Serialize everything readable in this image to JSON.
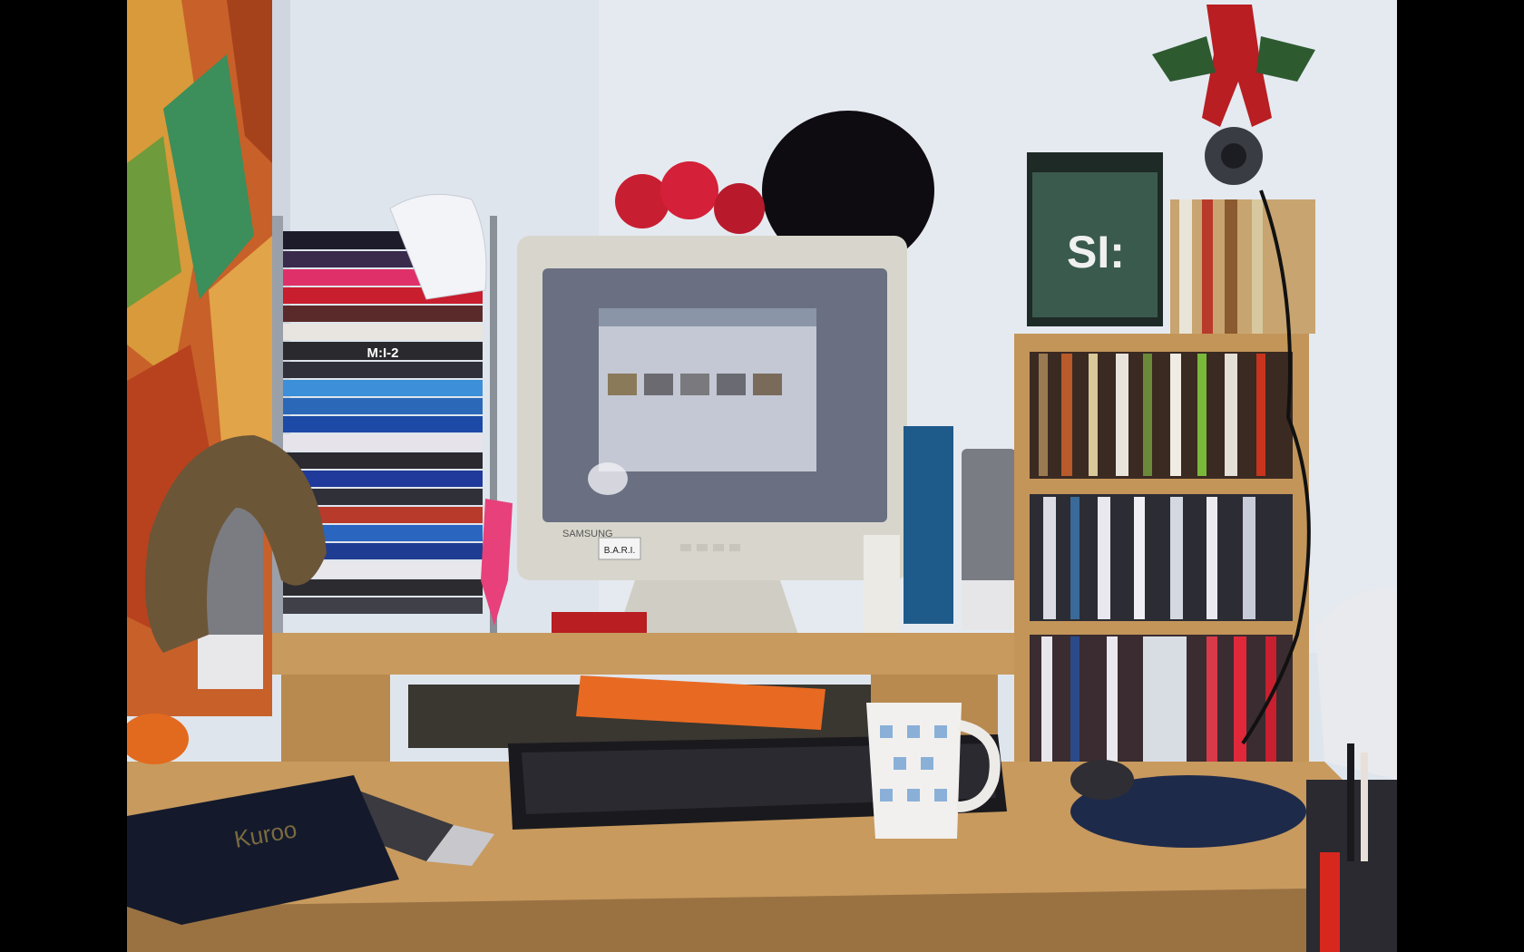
{
  "photo": {
    "monitor_brand": "SAMSUNG",
    "monitor_sticker": "B.A.R.I.",
    "dvd_titles": [
      "M:I-2"
    ],
    "game_box_text": "SI:",
    "notebook_cover_text": "Kuroo"
  },
  "colors": {
    "wall": "#dde4ec",
    "desk": "#c89a5e",
    "curtain": "#c8602a",
    "shelf": "#c39559",
    "monitor_beige": "#d8d6cc",
    "screen": "#6a7082"
  }
}
